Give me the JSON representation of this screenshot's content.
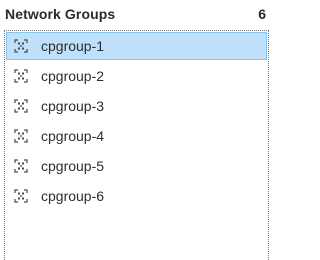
{
  "header": {
    "title": "Network Groups",
    "count": "6"
  },
  "groups": {
    "items": [
      {
        "label": "cpgroup-1",
        "icon": "network-group-icon",
        "selected": true
      },
      {
        "label": "cpgroup-2",
        "icon": "network-group-icon",
        "selected": false
      },
      {
        "label": "cpgroup-3",
        "icon": "network-group-icon",
        "selected": false
      },
      {
        "label": "cpgroup-4",
        "icon": "network-group-icon",
        "selected": false
      },
      {
        "label": "cpgroup-5",
        "icon": "network-group-icon",
        "selected": false
      },
      {
        "label": "cpgroup-6",
        "icon": "network-group-icon",
        "selected": false
      }
    ]
  },
  "colors": {
    "selected_background": "#bfe0fa",
    "selected_border": "#89c3f0",
    "icon": "#4a4a4a"
  }
}
